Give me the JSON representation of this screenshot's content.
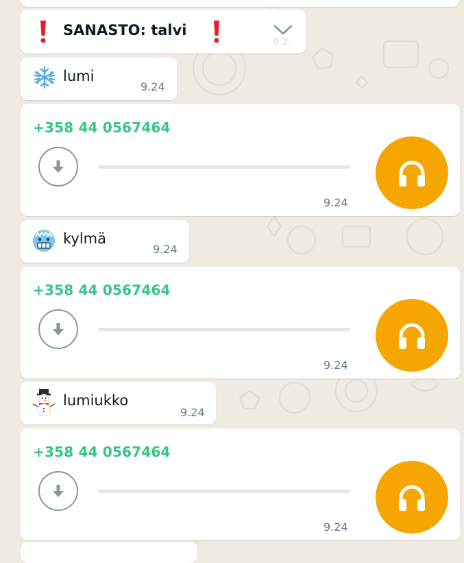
{
  "colors": {
    "chat_background": "#efeae2",
    "bubble": "#ffffff",
    "sender_name": "#35c586",
    "audio_avatar": "#f6a600",
    "alert_red": "#e0202c",
    "timestamp": "#667781"
  },
  "pinned_header": {
    "title": "SANASTO: talvi",
    "left_icon": "exclamation-icon",
    "right_icon": "exclamation-icon",
    "menu_icon": "chevron-down-icon",
    "faded_time": "9.2."
  },
  "messages": [
    {
      "type": "text",
      "icon": "snowflake-icon",
      "text": "lumi",
      "time": "9.24"
    },
    {
      "type": "voice",
      "sender": "+358 44 0567464",
      "time": "9.24",
      "icon": "headphones-icon"
    },
    {
      "type": "text",
      "icon": "cold-face-icon",
      "text": "kylmä",
      "time": "9.24"
    },
    {
      "type": "voice",
      "sender": "+358 44 0567464",
      "time": "9.24",
      "icon": "headphones-icon"
    },
    {
      "type": "text",
      "icon": "snowman-icon",
      "text": "lumiukko",
      "time": "9.24"
    },
    {
      "type": "voice",
      "sender": "+358 44 0567464",
      "time": "9.24",
      "icon": "headphones-icon"
    }
  ]
}
